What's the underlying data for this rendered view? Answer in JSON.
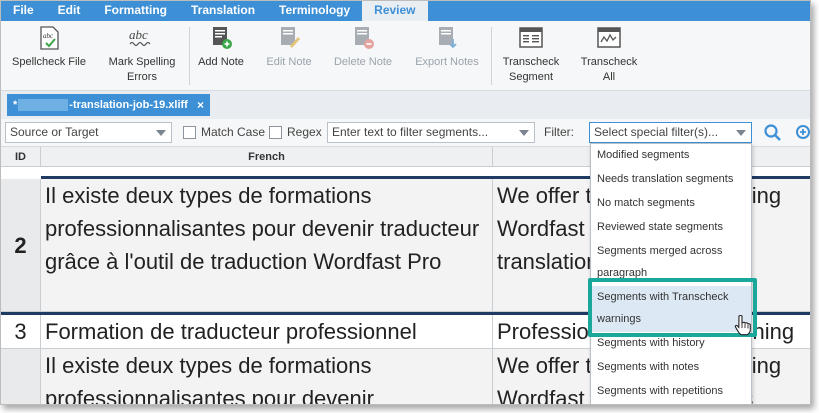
{
  "menu": {
    "items": [
      {
        "label": "File"
      },
      {
        "label": "Edit"
      },
      {
        "label": "Formatting"
      },
      {
        "label": "Translation"
      },
      {
        "label": "Terminology"
      },
      {
        "label": "Review"
      }
    ],
    "active": "Review"
  },
  "ribbon": {
    "spellcheck_file": "Spellcheck File",
    "mark_spelling_1": "Mark Spelling",
    "mark_spelling_2": "Errors",
    "add_note": "Add Note",
    "edit_note": "Edit Note",
    "delete_note": "Delete Note",
    "export_notes": "Export Notes",
    "transcheck_segment_1": "Transcheck",
    "transcheck_segment_2": "Segment",
    "transcheck_all_1": "Transcheck",
    "transcheck_all_2": "All",
    "abc_glyph": "abc"
  },
  "tab": {
    "prefix": "*",
    "suffix": "-translation-job-19.xliff",
    "close": "×"
  },
  "filterbar": {
    "scope_value": "Source or Target",
    "match_case_label": "Match Case",
    "regex_label": "Regex",
    "filter_placeholder": "Enter text to filter segments...",
    "filter_label": "Filter:",
    "special_filter_value": "Select special filter(s)..."
  },
  "grid": {
    "headers": {
      "id": "ID",
      "source": "French"
    },
    "rows": [
      {
        "id": "2",
        "source": "Il existe deux types de formations professionnalisantes pour devenir traducteur grâce à l'outil de traduction Wordfast Pro",
        "target_lines": [
          "We offer two types of training",
          "Wordfast Pro translator-a",
          "translation tool"
        ]
      },
      {
        "id": "3",
        "source": "Formation de traducteur professionnel",
        "target_lines": [
          "Professional translator training"
        ]
      },
      {
        "id": "",
        "source": "Il existe deux types de formations professionnalisantes pour devenir",
        "target_lines": [
          "We offer two types of training",
          "Wordfast Pro translator-as"
        ]
      }
    ]
  },
  "special_filter_dropdown": {
    "items": [
      "Modified segments",
      "Needs translation segments",
      "No match segments",
      "Reviewed state segments",
      "Segments merged across",
      "paragraph",
      "Segments with Transcheck",
      "warnings",
      "Segments with history",
      "Segments with notes",
      "Segments with repetitions"
    ],
    "highlighted": "Segments with Transcheck warnings"
  },
  "colors": {
    "menu_bar": "#3d8fd6",
    "highlight_box": "#19a89a",
    "selected_row_border": "#1f3a63"
  }
}
